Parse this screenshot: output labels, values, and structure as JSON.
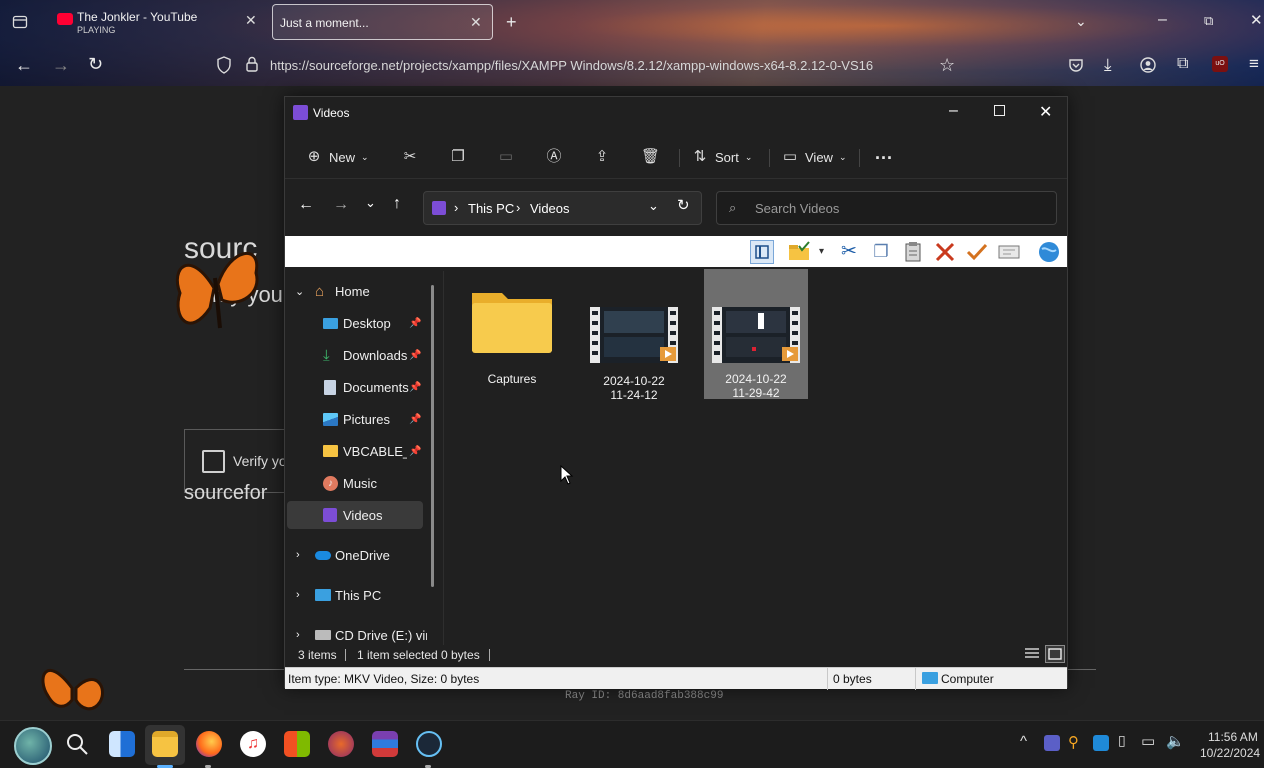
{
  "browser": {
    "tabs": [
      {
        "title": "The Jonkler - YouTube",
        "subtitle": "PLAYING"
      },
      {
        "title": "Just a moment..."
      }
    ],
    "url": "https://sourceforge.net/projects/xampp/files/XAMPP Windows/8.2.12/xampp-windows-x64-8.2.12-0-VS16"
  },
  "page": {
    "heading_fragment": "sourc",
    "subheading_fragment": "rify you",
    "verify_label": "Verify yo",
    "footer_fragment": "sourcefor",
    "ray_id": "Ray ID: 8d6aad8fab388c99"
  },
  "explorer": {
    "title": "Videos",
    "toolbar": {
      "new_label": "New",
      "sort_label": "Sort",
      "view_label": "View",
      "more_label": "..."
    },
    "breadcrumb": [
      "This PC",
      "Videos"
    ],
    "search_placeholder": "Search Videos",
    "nav": {
      "home": "Home",
      "desktop": "Desktop",
      "downloads": "Downloads",
      "documents": "Documents",
      "pictures": "Pictures",
      "vbcable": "VBCABLE_Dı",
      "music": "Music",
      "videos": "Videos",
      "onedrive": "OneDrive",
      "thispc": "This PC",
      "cddrive": "CD Drive (E:) virti"
    },
    "files": [
      {
        "name": "Captures",
        "line2": ""
      },
      {
        "name": "2024-10-22",
        "line2": "11-24-12"
      },
      {
        "name": "2024-10-22",
        "line2": "11-29-42"
      }
    ],
    "status": {
      "items": "3 items",
      "selected": "1 item selected",
      "size": "0 bytes"
    },
    "legacy_status": {
      "item_type": "Item type: MKV Video, Size: 0 bytes",
      "bytes": "0 bytes",
      "computer": "Computer"
    }
  },
  "taskbar": {
    "time": "11:56 AM",
    "date": "10/22/2024"
  },
  "colors": {
    "accent": "#0067c0",
    "folder": "#f6c342",
    "selected": "#6e6e6e"
  }
}
